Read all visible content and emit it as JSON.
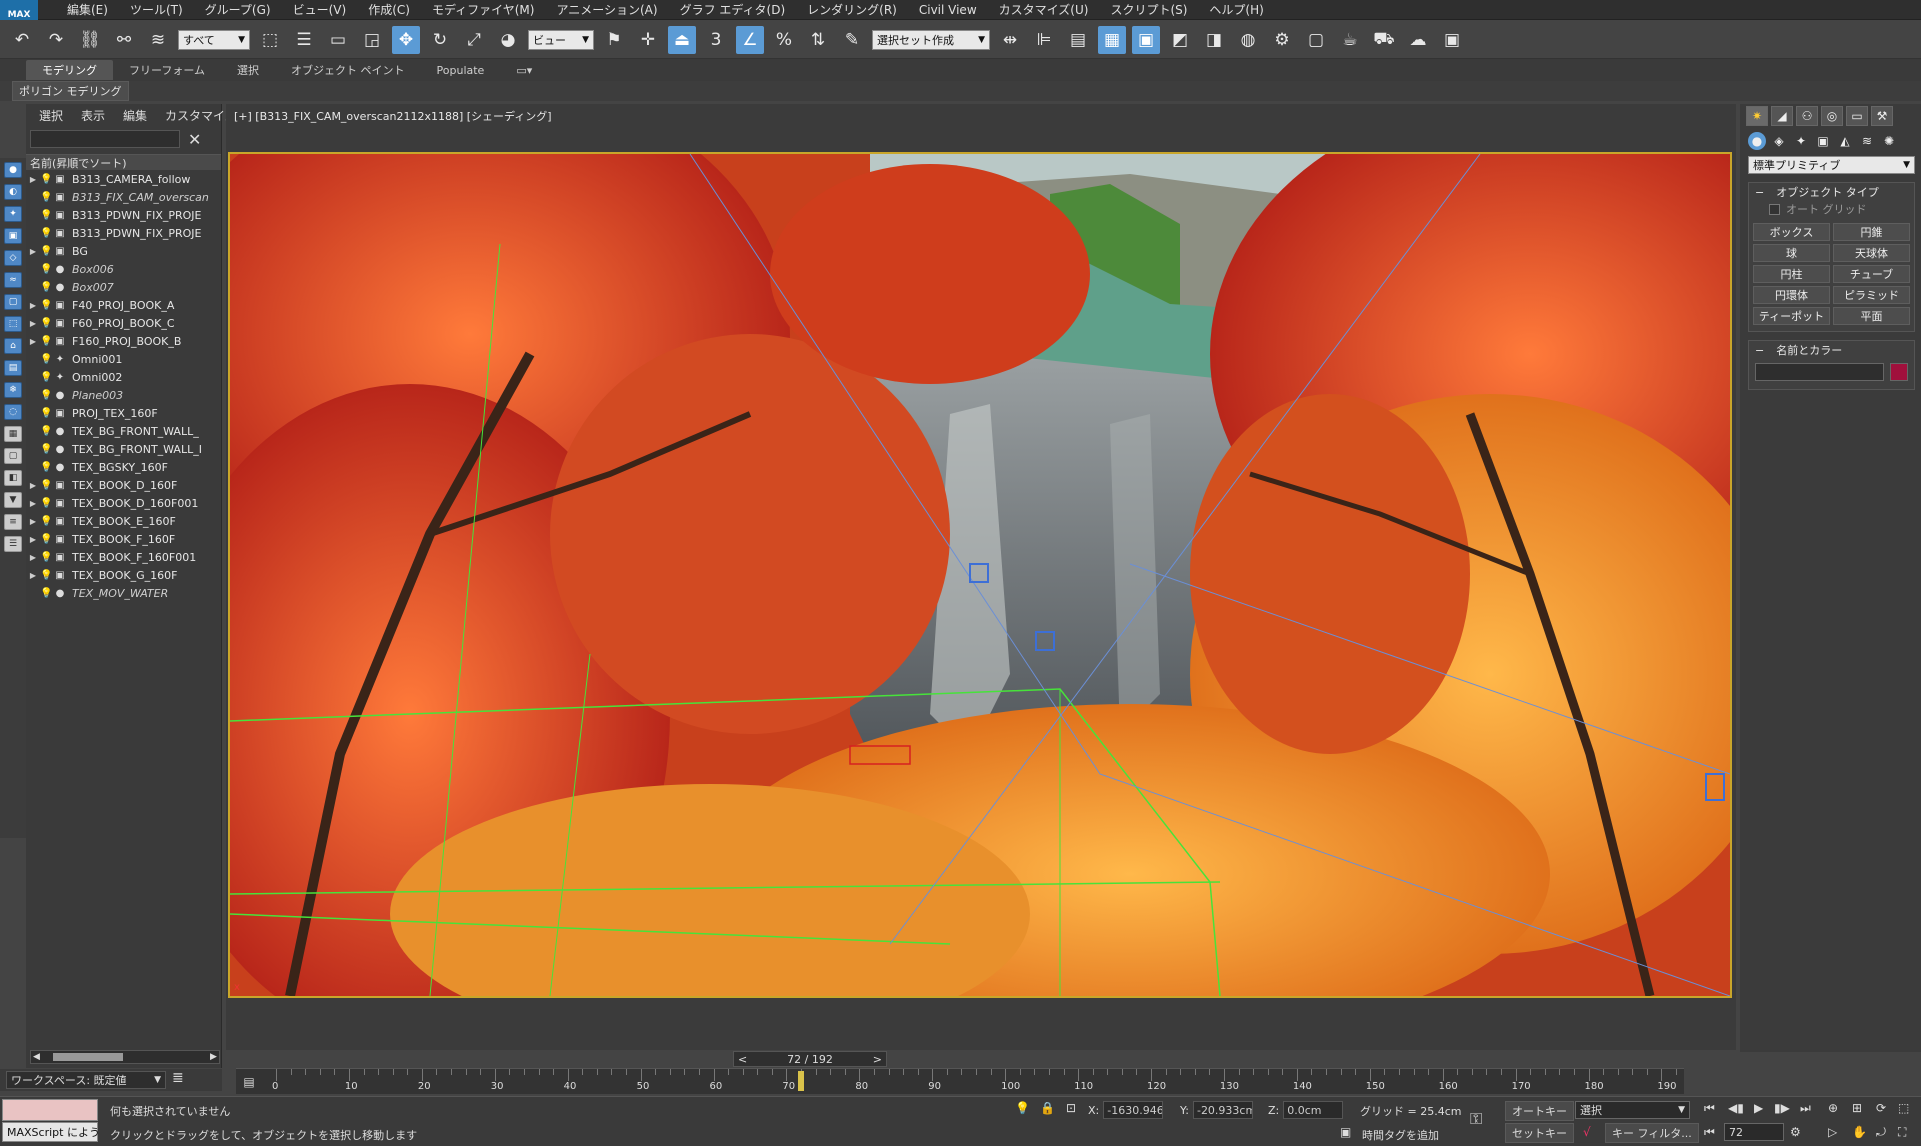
{
  "app": {
    "logo": "MAX"
  },
  "menu": [
    "編集(E)",
    "ツール(T)",
    "グループ(G)",
    "ビュー(V)",
    "作成(C)",
    "モディファイヤ(M)",
    "アニメーション(A)",
    "グラフ エディタ(D)",
    "レンダリング(R)",
    "Civil View",
    "カスタマイズ(U)",
    "スクリプト(S)",
    "ヘルプ(H)"
  ],
  "toolbar": {
    "filter_select": "すべて",
    "refcoord_select": "ビュー",
    "selset_select": "選択セット作成",
    "snap_label": "3",
    "icons": [
      "undo-icon",
      "redo-icon",
      "link-icon",
      "unlink-icon",
      "bind-space-warp-icon",
      "select-object-icon",
      "select-by-name-icon",
      "rect-region-icon",
      "window-crossing-icon",
      "move-icon",
      "rotate-icon",
      "scale-icon",
      "placement-icon",
      "pivot-icon",
      "manipulate-icon",
      "keyboard-shortcut-icon",
      "snap-icon",
      "angle-snap-icon",
      "percent-snap-icon",
      "spinner-snap-icon",
      "edit-named-sel-icon",
      "mirror-icon",
      "align-icon",
      "layer-explorer-icon",
      "scene-explorer-icon",
      "toggle-ribbon-icon",
      "curve-editor-icon",
      "schematic-view-icon",
      "material-editor-icon",
      "render-setup-icon",
      "rendered-frame-icon",
      "render-icon",
      "render-iterative-icon",
      "render-cloud-icon",
      "a360-icon"
    ]
  },
  "ribbon": {
    "tabs": [
      "モデリング",
      "フリーフォーム",
      "選択",
      "オブジェクト ペイント",
      "Populate"
    ],
    "active": 0,
    "subpanel": "ポリゴン モデリング"
  },
  "explorer": {
    "tabs": [
      "選択",
      "表示",
      "編集",
      "カスタマイズ"
    ],
    "header": "名前(昇順でソート)",
    "rows": [
      {
        "name": "B313_CAMERA_follow",
        "expand": "▶",
        "italic": false,
        "obj": "▣"
      },
      {
        "name": "B313_FIX_CAM_overscan",
        "expand": "",
        "italic": true,
        "obj": "▣"
      },
      {
        "name": "B313_PDWN_FIX_PROJE",
        "expand": "",
        "italic": false,
        "obj": "▣"
      },
      {
        "name": "B313_PDWN_FIX_PROJE",
        "expand": "",
        "italic": false,
        "obj": "▣"
      },
      {
        "name": "BG",
        "expand": "▶",
        "italic": false,
        "obj": "▣"
      },
      {
        "name": "Box006",
        "expand": "",
        "italic": true,
        "obj": "●"
      },
      {
        "name": "Box007",
        "expand": "",
        "italic": true,
        "obj": "●"
      },
      {
        "name": "F40_PROJ_BOOK_A",
        "expand": "▶",
        "italic": false,
        "obj": "▣"
      },
      {
        "name": "F60_PROJ_BOOK_C",
        "expand": "▶",
        "italic": false,
        "obj": "▣"
      },
      {
        "name": "F160_PROJ_BOOK_B",
        "expand": "▶",
        "italic": false,
        "obj": "▣"
      },
      {
        "name": "Omni001",
        "expand": "",
        "italic": false,
        "obj": "✦"
      },
      {
        "name": "Omni002",
        "expand": "",
        "italic": false,
        "obj": "✦"
      },
      {
        "name": "Plane003",
        "expand": "",
        "italic": true,
        "obj": "●"
      },
      {
        "name": "PROJ_TEX_160F",
        "expand": "",
        "italic": false,
        "obj": "▣"
      },
      {
        "name": "TEX_BG_FRONT_WALL_",
        "expand": "",
        "italic": false,
        "obj": "●"
      },
      {
        "name": "TEX_BG_FRONT_WALL_I",
        "expand": "",
        "italic": false,
        "obj": "●"
      },
      {
        "name": "TEX_BGSKY_160F",
        "expand": "",
        "italic": false,
        "obj": "●"
      },
      {
        "name": "TEX_BOOK_D_160F",
        "expand": "▶",
        "italic": false,
        "obj": "▣"
      },
      {
        "name": "TEX_BOOK_D_160F001",
        "expand": "▶",
        "italic": false,
        "obj": "▣"
      },
      {
        "name": "TEX_BOOK_E_160F",
        "expand": "▶",
        "italic": false,
        "obj": "▣"
      },
      {
        "name": "TEX_BOOK_F_160F",
        "expand": "▶",
        "italic": false,
        "obj": "▣"
      },
      {
        "name": "TEX_BOOK_F_160F001",
        "expand": "▶",
        "italic": false,
        "obj": "▣"
      },
      {
        "name": "TEX_BOOK_G_160F",
        "expand": "▶",
        "italic": false,
        "obj": "▣"
      },
      {
        "name": "TEX_MOV_WATER",
        "expand": "",
        "italic": true,
        "obj": "●"
      }
    ]
  },
  "viewport": {
    "label": "[+] [B313_FIX_CAM_overscan2112x1188] [シェーディング]"
  },
  "command_panel": {
    "tabs": [
      "create-icon",
      "modify-icon",
      "hierarchy-icon",
      "motion-icon",
      "display-icon",
      "utilities-icon"
    ],
    "category": "標準プリミティブ",
    "object_type_title": "オブジェクト タイプ",
    "autogrid": "オート グリッド",
    "buttons": [
      "ボックス",
      "円錐",
      "球",
      "天球体",
      "円柱",
      "チューブ",
      "円環体",
      "ピラミッド",
      "ティーポット",
      "平面"
    ],
    "name_color_title": "名前とカラー",
    "object_color": "#a0103c"
  },
  "workspace": {
    "label": "ワークスペース: 既定値"
  },
  "timeline": {
    "frame_display": "72 / 192",
    "current": 72,
    "max": 192,
    "labels": [
      "0",
      "10",
      "20",
      "30",
      "40",
      "50",
      "60",
      "70",
      "80",
      "90",
      "100",
      "110",
      "120",
      "130",
      "140",
      "150",
      "160",
      "170",
      "180",
      "190"
    ]
  },
  "status": {
    "maxscript": "MAXScript によう",
    "line1": "何も選択されていません",
    "line2": "クリックとドラッグをして、オブジェクトを選択し移動します",
    "x_label": "X:",
    "x_value": "-1630.946",
    "y_label": "Y:",
    "y_value": "-20.933cm",
    "z_label": "Z:",
    "z_value": "0.0cm",
    "grid": "グリッド = 25.4cm",
    "add_time_tag": "時間タグを追加",
    "autokey": "オートキー",
    "setkey": "セットキー",
    "selection": "選択",
    "key_filter": "キー フィルタ...",
    "frame": "72"
  }
}
